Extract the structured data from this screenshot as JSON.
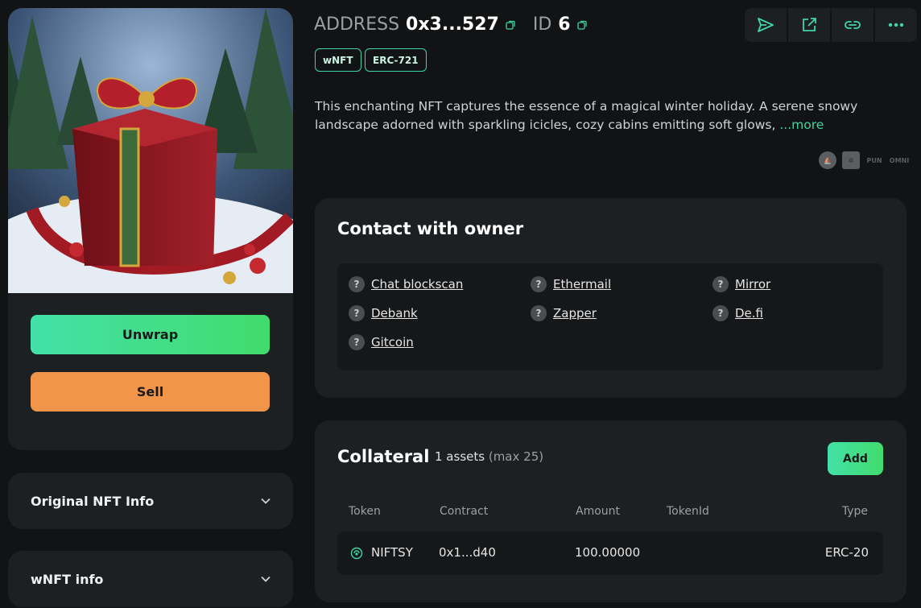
{
  "header": {
    "address_label": "ADDRESS",
    "address_value": "0x3...527",
    "id_label": "ID",
    "id_value": "6"
  },
  "toolbar": {
    "icons": [
      "send-icon",
      "external-link-icon",
      "link-icon",
      "more-icon"
    ]
  },
  "tags": [
    "wNFT",
    "ERC-721"
  ],
  "description": {
    "text": "This enchanting NFT captures the essence of a magical winter holiday. A serene snowy landscape adorned with sparkling icicles, cozy cabins emitting soft glows,",
    "more_label": "...more"
  },
  "marketplaces": [
    "opensea",
    "looksrare",
    "pun",
    "omni"
  ],
  "actions": {
    "unwrap_label": "Unwrap",
    "sell_label": "Sell"
  },
  "accordions": {
    "original_label": "Original NFT Info",
    "wnft_label": "wNFT info"
  },
  "contact": {
    "title": "Contact with owner",
    "links": [
      "Chat blockscan",
      "Ethermail",
      "Mirror",
      "Debank",
      "Zapper",
      "De.fi",
      "Gitcoin"
    ]
  },
  "collateral": {
    "title": "Collateral",
    "count": "1 assets",
    "max": "(max 25)",
    "add_label": "Add",
    "columns": [
      "Token",
      "Contract",
      "Amount",
      "TokenId",
      "Type"
    ],
    "rows": [
      {
        "token": "NIFTSY",
        "contract": "0x1...d40",
        "amount": "100.00000",
        "tokenid": "",
        "type": "ERC-20"
      }
    ]
  },
  "colors": {
    "accent": "#3fd7a3",
    "sell": "#f0954a",
    "card": "#1d2022",
    "background": "#111315"
  }
}
